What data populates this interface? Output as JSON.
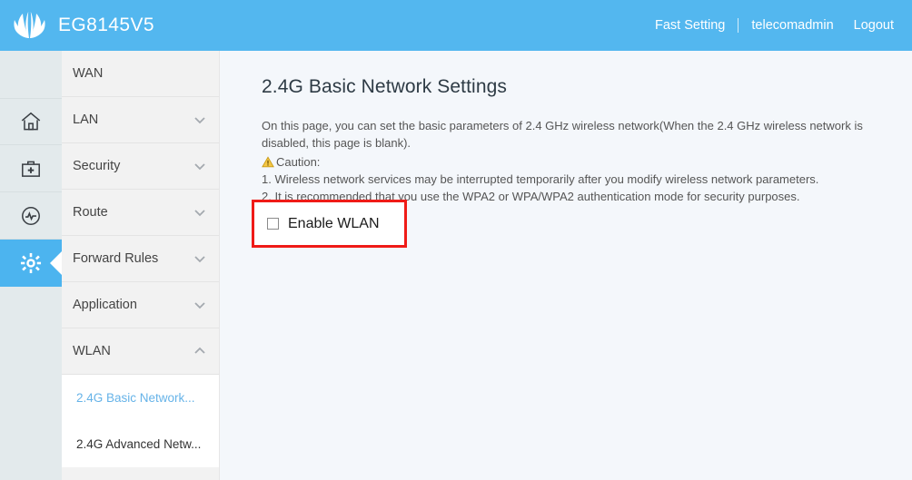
{
  "header": {
    "brand_name": "EG8145V5",
    "logo_icon": "huawei-logo",
    "fast_setting": "Fast Setting",
    "username": "telecomadmin",
    "logout": "Logout"
  },
  "rail": {
    "items": [
      {
        "icon": "home-icon",
        "name": "home",
        "active": false
      },
      {
        "icon": "toolkit-icon",
        "name": "toolkit",
        "active": false
      },
      {
        "icon": "diagnostics-icon",
        "name": "diagnostics",
        "active": false
      },
      {
        "icon": "gear-icon",
        "name": "settings",
        "active": true
      }
    ]
  },
  "sidebar": {
    "items": [
      {
        "label": "WAN",
        "chevron": "none"
      },
      {
        "label": "LAN",
        "chevron": "down"
      },
      {
        "label": "Security",
        "chevron": "down"
      },
      {
        "label": "Route",
        "chevron": "down"
      },
      {
        "label": "Forward Rules",
        "chevron": "down"
      },
      {
        "label": "Application",
        "chevron": "down"
      },
      {
        "label": "WLAN",
        "chevron": "up"
      }
    ],
    "submenu": [
      {
        "label": "2.4G Basic Network...",
        "selected": true
      },
      {
        "label": "2.4G Advanced Netw...",
        "selected": false
      }
    ]
  },
  "main": {
    "title": "2.4G Basic Network Settings",
    "desc_line1": "On this page, you can set the basic parameters of 2.4 GHz wireless network(When the 2.4 GHz wireless network is disabled, this page is blank).",
    "caution_label": "Caution:",
    "caution_icon": "warning-triangle-icon",
    "caution_1": "1. Wireless network services may be interrupted temporarily after you modify wireless network parameters.",
    "caution_2": "2. It is recommended that you use the WPA2 or WPA/WPA2 authentication mode for security purposes.",
    "enable_wlan_label": "Enable WLAN",
    "enable_wlan_checked": false,
    "highlight_color": "#ef1b17"
  },
  "colors": {
    "header_blue": "#53b7ef",
    "active_tile": "#4cb4ef",
    "rail_bg": "#e3eaec",
    "sidebar_bg": "#f2f2f2",
    "content_bg": "#f4f7fb",
    "selected_link": "#66b3e8"
  }
}
